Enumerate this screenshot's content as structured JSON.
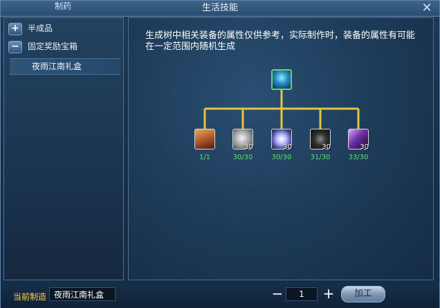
{
  "window": {
    "title": "生活技能",
    "tab": "制药"
  },
  "sidebar": {
    "categories": [
      {
        "label": "半成品",
        "toggle": "+"
      },
      {
        "label": "固定奖励宝箱",
        "toggle": "−"
      }
    ],
    "items": [
      {
        "label": "夜雨江南礼盒"
      }
    ]
  },
  "main": {
    "description": "生成树中相关装备的属性仅供参考，实际制作时，装备的属性有可能在一定范围内随机生成",
    "root": {
      "icon": "blue-crystal-icon"
    },
    "materials": [
      {
        "icon": "book-icon",
        "count": "",
        "progress": "1/1"
      },
      {
        "icon": "silver-coin-icon",
        "count": "30",
        "progress": "30/30"
      },
      {
        "icon": "white-gem-icon",
        "count": "30",
        "progress": "30/30"
      },
      {
        "icon": "black-rope-icon",
        "count": "30",
        "progress": "31/30"
      },
      {
        "icon": "purple-blade-icon",
        "count": "30",
        "progress": "33/30"
      }
    ]
  },
  "footer": {
    "current_label": "当前制造",
    "current_value": "夜雨江南礼盒",
    "quantity": "1",
    "minus": "−",
    "plus": "+",
    "craft_label": "加工"
  },
  "colors": {
    "tree_line": "#e6c43b",
    "progress_text": "#5fe06c",
    "accent_label": "#ffcf5a"
  }
}
